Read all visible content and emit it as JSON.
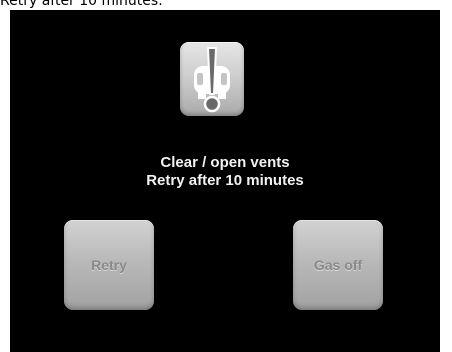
{
  "caption": "Retry after 10 minutes.",
  "icon": {
    "name": "boiler-alert-icon",
    "colors": {
      "panel": "#c9c9c9",
      "glyph": "#ffffff",
      "exclamation": "#707070"
    }
  },
  "message": {
    "line1": "Clear / open vents",
    "line2": "Retry after 10 minutes"
  },
  "buttons": {
    "retry_label": "Retry",
    "gas_off_label": "Gas off"
  },
  "colors": {
    "screen_background": "#000000",
    "message_text": "#f2f2f2",
    "button_face": "#b9b9b9",
    "button_text": "#8a8a8a"
  }
}
